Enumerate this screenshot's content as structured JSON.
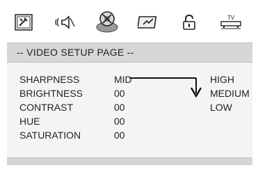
{
  "icons": [
    {
      "name": "general-setup-icon"
    },
    {
      "name": "audio-setup-icon"
    },
    {
      "name": "video-setup-icon",
      "selected": true
    },
    {
      "name": "preference-icon"
    },
    {
      "name": "password-lock-icon"
    },
    {
      "name": "tv-display-icon",
      "label": "TV"
    }
  ],
  "page": {
    "title": "-- VIDEO SETUP PAGE --"
  },
  "settings": [
    {
      "label": "SHARPNESS",
      "value": "MID"
    },
    {
      "label": "BRIGHTNESS",
      "value": "00"
    },
    {
      "label": "CONTRAST",
      "value": "00"
    },
    {
      "label": "HUE",
      "value": "00"
    },
    {
      "label": "SATURATION",
      "value": "00"
    }
  ],
  "options": [
    "HIGH",
    "MEDIUM",
    "LOW"
  ]
}
